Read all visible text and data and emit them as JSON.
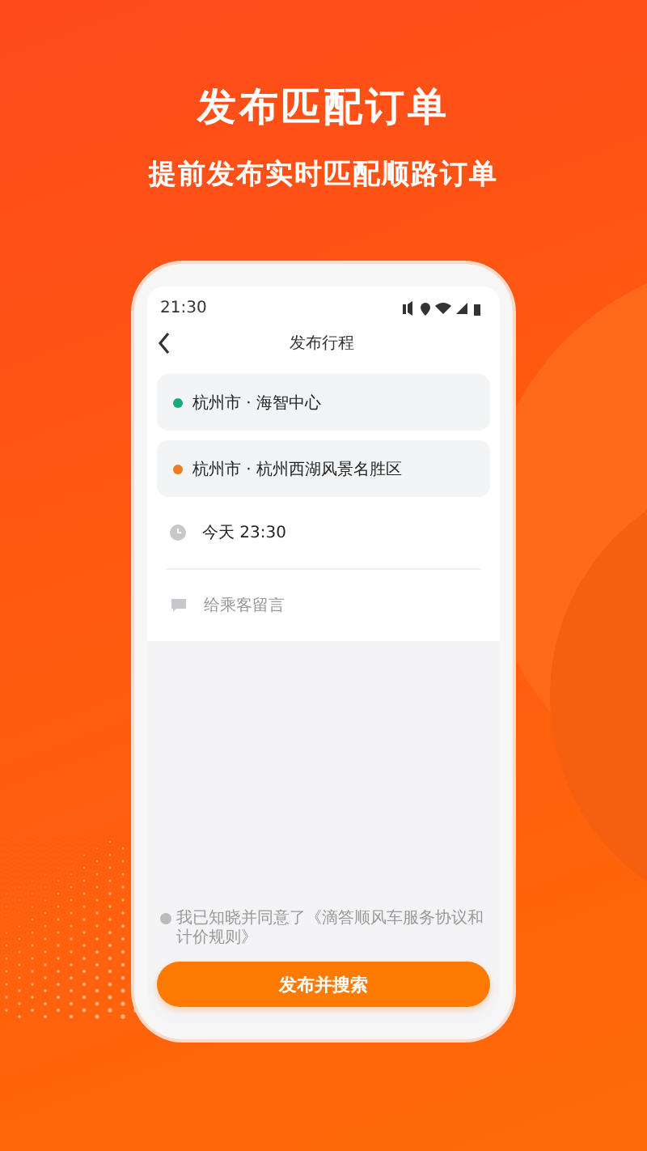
{
  "headline": "发布匹配订单",
  "subheadline": "提前发布实时匹配顺路订单",
  "phone": {
    "status_bar": {
      "time": "21:30"
    },
    "nav": {
      "title": "发布行程"
    },
    "route": [
      {
        "text": "杭州市 · 海智中心",
        "color": "#1aaa7a"
      },
      {
        "text": "杭州市 · 杭州西湖风景名胜区",
        "color": "#f07a20"
      }
    ],
    "time_row": {
      "text": "今天 23:30"
    },
    "message_field": {
      "placeholder": "给乘客留言"
    },
    "agreement": {
      "text": "我已知晓并同意了《滴答顺风车服务协议和计价规则》",
      "checked": false
    },
    "submit_button": "发布并搜索"
  }
}
